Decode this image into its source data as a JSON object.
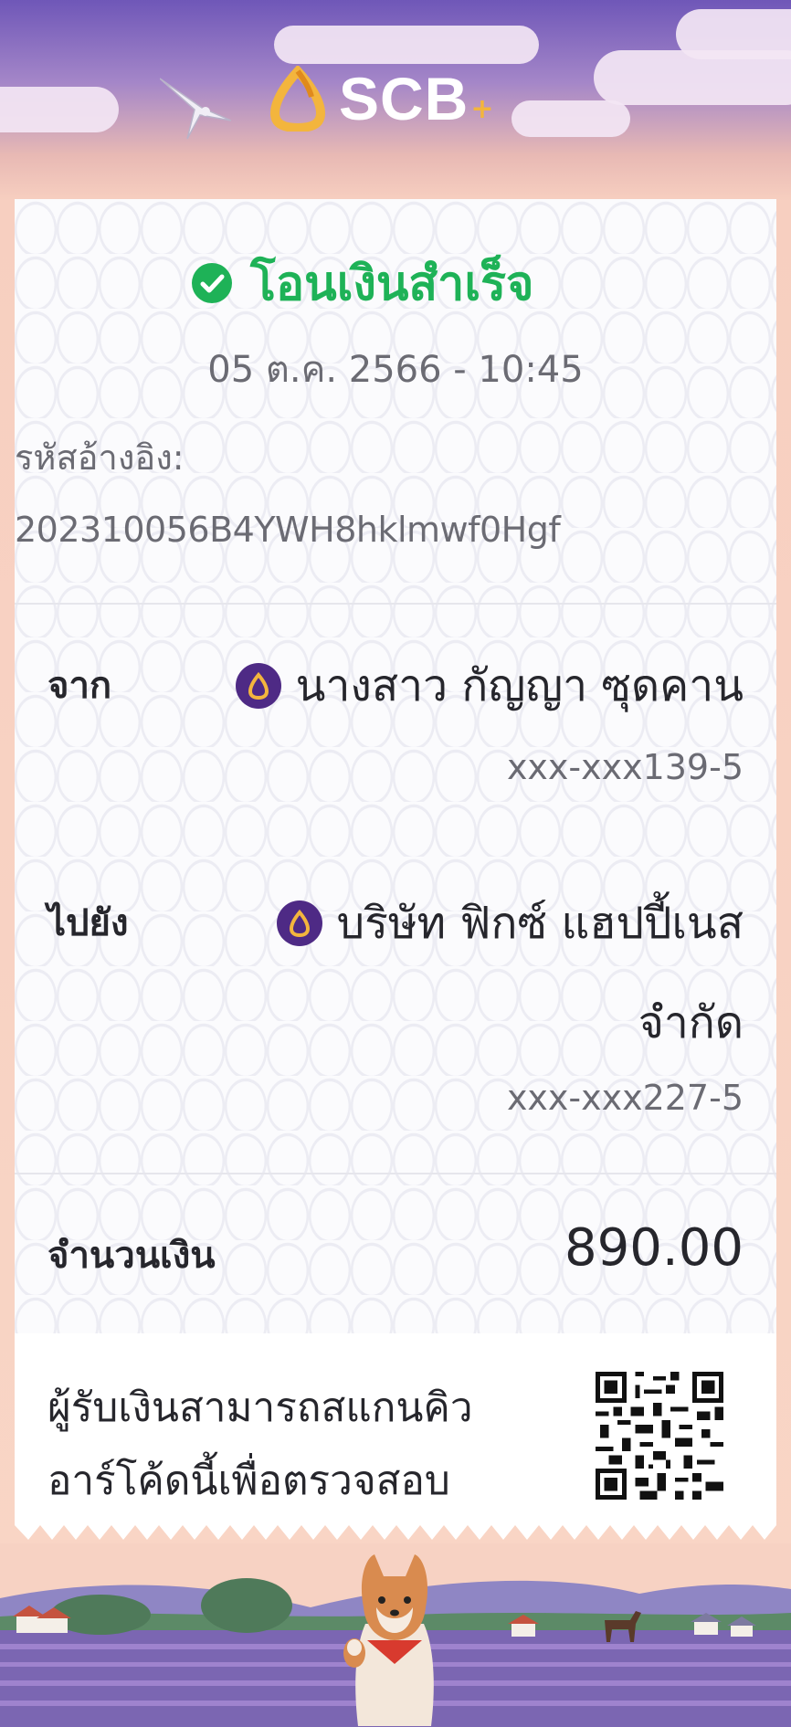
{
  "header": {
    "logo_text": "SCB",
    "logo_plus": "+"
  },
  "slip": {
    "status": "โอนเงินสำเร็จ",
    "datetime": "05 ต.ค. 2566 - 10:45",
    "ref_label": "รหัสอ้างอิง:",
    "ref_value": "202310056B4YWH8hklmwf0Hgf"
  },
  "from": {
    "label": "จาก",
    "name": "นางสาว กัญญา ซุดคาน",
    "account": "xxx-xxx139-5"
  },
  "to": {
    "label": "ไปยัง",
    "name_line1": "บริษัท ฟิกซ์ แฮปปี้เนส",
    "name_line2": "จำกัด",
    "account": "xxx-xxx227-5"
  },
  "amount": {
    "label": "จำนวนเงิน",
    "value": "890.00"
  },
  "qr_note": {
    "line1": "ผู้รับเงินสามารถสแกนคิว",
    "line2": "อาร์โค้ดนี้เพื่อตรวจสอบ"
  },
  "colors": {
    "success": "#1eb257",
    "brand_purple": "#4e2a85",
    "brand_gold": "#f3b53d"
  },
  "icons": [
    "scb-logo-icon",
    "bird-icon",
    "check-circle-icon",
    "scb-bank-icon",
    "qr-code-icon",
    "shiba-dog-icon"
  ]
}
